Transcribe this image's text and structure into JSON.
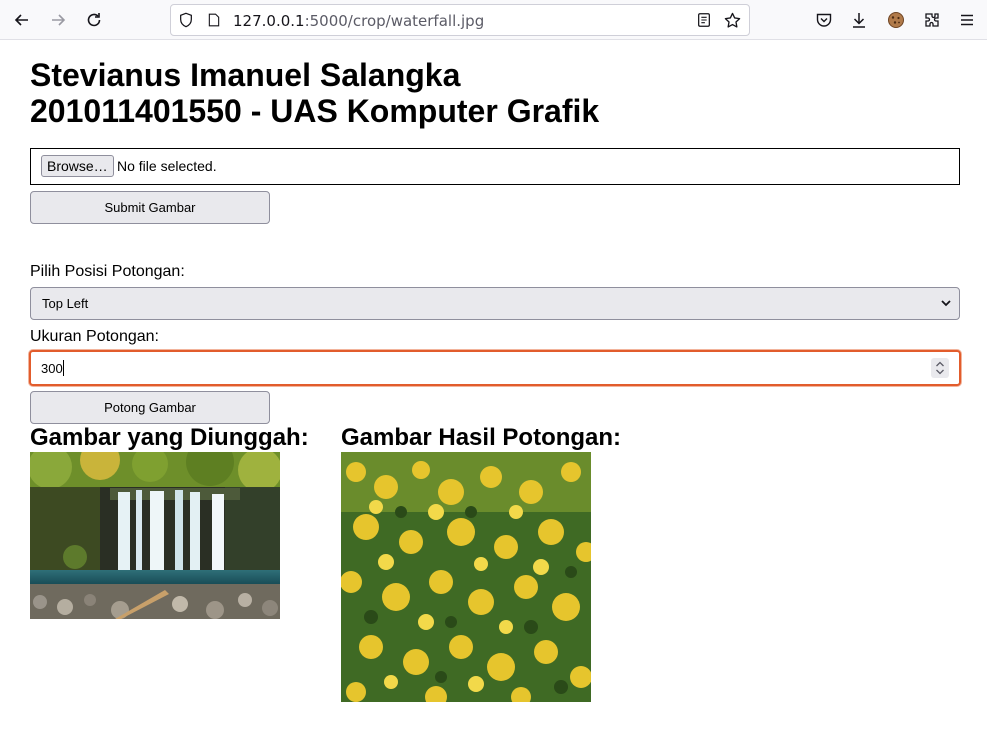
{
  "browser": {
    "url_host": "127.0.0.1",
    "url_rest": ":5000/crop/waterfall.jpg"
  },
  "page": {
    "title_line1": "Stevianus Imanuel Salangka",
    "title_line2": "201011401550 - UAS Komputer Grafik",
    "browse_label": "Browse…",
    "no_file_text": "No file selected.",
    "submit_label": "Submit Gambar",
    "position_label": "Pilih Posisi Potongan:",
    "position_value": "Top Left",
    "size_label": "Ukuran Potongan:",
    "size_value": "300",
    "crop_label": "Potong Gambar",
    "uploaded_heading": "Gambar yang Diunggah:",
    "result_heading": "Gambar Hasil Potongan:"
  },
  "icons": {
    "back": "arrow-left-icon",
    "forward": "arrow-right-icon",
    "reload": "reload-icon",
    "shield": "shield-icon",
    "page": "page-icon",
    "reader": "reader-view-icon",
    "bookmark": "star-icon",
    "pocket": "pocket-icon",
    "downloads": "download-icon",
    "cookie": "cookie-icon",
    "extensions": "extensions-icon",
    "menu": "hamburger-menu-icon"
  },
  "colors": {
    "focus_border": "#e25c2c",
    "button_bg": "#e9e9ed"
  }
}
